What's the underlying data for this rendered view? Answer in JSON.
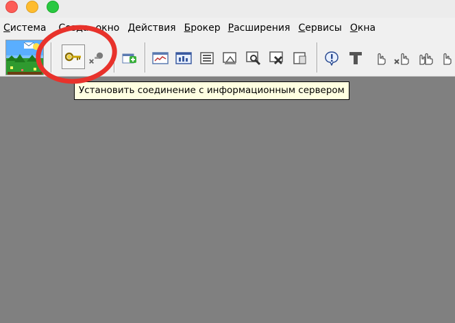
{
  "window": {
    "controls": [
      "close",
      "minimize",
      "maximize"
    ]
  },
  "menu": {
    "items": [
      {
        "label": "Система",
        "underline": "С",
        "rest": "истема"
      },
      {
        "label": "Создать",
        "underline": "С",
        "rest": "озда"
      },
      {
        "label": "окно",
        "underline": "",
        "rest": "окно"
      },
      {
        "label": "Действия",
        "underline": "Д",
        "rest": "ействия"
      },
      {
        "label": "Брокер",
        "underline": "Б",
        "rest": "рокер"
      },
      {
        "label": "Расширения",
        "underline": "Р",
        "rest": "асширения"
      },
      {
        "label": "Сервисы",
        "underline": "С",
        "rest": "ервисы"
      },
      {
        "label": "Окна",
        "underline": "О",
        "rest": "кна"
      }
    ]
  },
  "toolbar": {
    "icons": [
      "app-logo-icon",
      "key-connect-icon",
      "disconnect-icon",
      "new-window-plus-icon",
      "chart-icon",
      "chart-window-icon",
      "list-icon",
      "chart-tool-icon",
      "search-chart-icon",
      "close-chart-icon",
      "document-icon",
      "info-icon",
      "text-tool-icon",
      "hand-icon",
      "hand-delete-icon",
      "hands-icon",
      "hand-more-icon"
    ],
    "pressed": "key-connect-icon"
  },
  "tooltip": {
    "text": "Установить соединение с информационным сервером"
  },
  "colors": {
    "workspace": "#808080",
    "tooltip_bg": "#ffffe1",
    "highlight": "#e8322b"
  }
}
